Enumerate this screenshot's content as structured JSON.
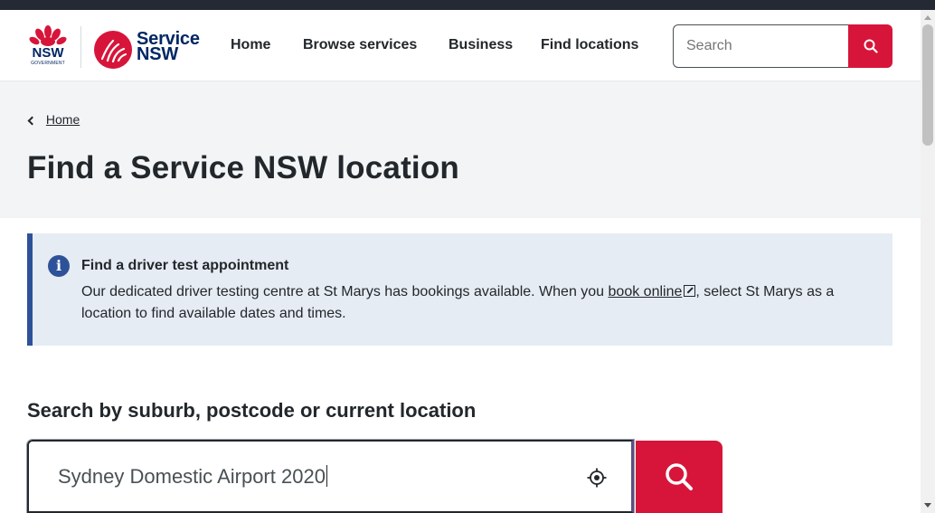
{
  "header": {
    "logo_nsw": "NSW",
    "logo_nsw_sub": "GOVERNMENT",
    "logo_service_line1": "Service",
    "logo_service_line2": "NSW",
    "nav": [
      {
        "label": "Home"
      },
      {
        "label": "Browse services"
      },
      {
        "label": "Business"
      },
      {
        "label": "Find locations"
      }
    ],
    "search_placeholder": "Search"
  },
  "breadcrumb": {
    "label": "Home"
  },
  "page_title": "Find a Service NSW location",
  "callout": {
    "title": "Find a driver test appointment",
    "body_before": "Our dedicated driver testing centre at St Marys has bookings available. When you ",
    "link": "book online",
    "body_after": ", select St Marys as a location to find available dates and times."
  },
  "location_search": {
    "label": "Search by suburb, postcode or current location",
    "value": "Sydney Domestic Airport 2020"
  },
  "colors": {
    "brand_red": "#d7153a",
    "brand_navy": "#002664",
    "info_blue": "#2e5299",
    "hero_bg": "#f2f4f6",
    "callout_bg": "#e6ecf3"
  }
}
